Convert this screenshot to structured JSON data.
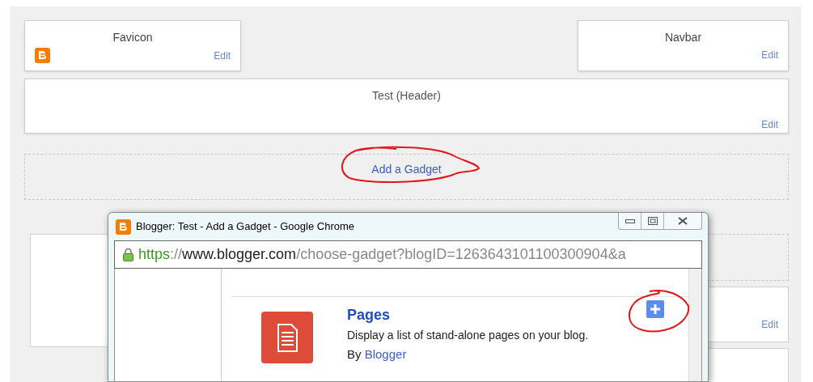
{
  "top_widgets": [
    {
      "kind": "favicon",
      "title": "Favicon",
      "edit": "Edit"
    },
    {
      "kind": "plain",
      "title": "Navbar",
      "edit": "Edit"
    }
  ],
  "header_widget": {
    "title": "Test (Header)",
    "edit": "Edit"
  },
  "add_gadget": "Add a Gadget",
  "right_widgets": [
    {
      "kind": "dashed"
    },
    {
      "kind": "widget",
      "edit": "Edit"
    },
    {
      "kind": "widget"
    }
  ],
  "popup": {
    "title": "Blogger: Test - Add a Gadget - Google Chrome",
    "url": {
      "scheme": "https",
      "separator": "://",
      "host": "www.blogger.com",
      "path": "/choose-gadget?blogID=1263643101100300904&a"
    },
    "gadget": {
      "name": "Pages",
      "description": "Display a list of stand-alone pages on your blog.",
      "by": "By",
      "author": "Blogger"
    }
  }
}
